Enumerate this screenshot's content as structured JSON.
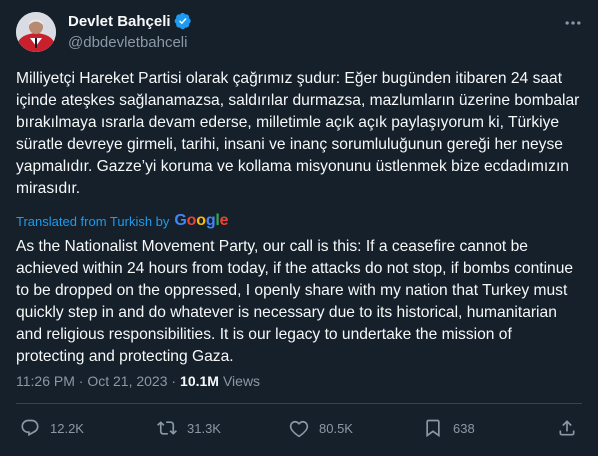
{
  "author": {
    "display_name": "Devlet Bahçeli",
    "handle": "@dbdevletbahceli"
  },
  "tweet": {
    "text": "Milliyetçi Hareket Partisi olarak çağrımız şudur: Eğer bugünden itibaren 24 saat içinde ateşkes sağlanamazsa, saldırılar durmazsa, mazlumların üzerine bombalar bırakılmaya ısrarla devam ederse, milletimle açık açık paylaşıyorum ki, Türkiye süratle devreye girmeli, tarihi, insani ve inanç sorumluluğunun gereği her neyse yapmalıdır. Gazze’yi koruma ve kollama misyonunu üstlenmek bize ecdadımızın mirasıdır.",
    "translated_label": "Translated from Turkish by",
    "translator": "Google",
    "translation": "As the Nationalist Movement Party, our call is this: If a ceasefire cannot be achieved within 24 hours from today, if the attacks do not stop, if bombs continue to be dropped on the oppressed, I openly share with my nation that Turkey must quickly step in and do whatever is necessary due to its historical, humanitarian and religious responsibilities. It is our legacy to undertake the mission of protecting and protecting Gaza.",
    "timestamp": "11:26 PM · Oct 21, 2023 ·",
    "views_count": "10.1M",
    "views_label": "Views"
  },
  "actions": {
    "replies": "12.2K",
    "retweets": "31.3K",
    "likes": "80.5K",
    "bookmarks": "638"
  },
  "colors": {
    "background": "#15202b",
    "text": "#f7f9f9",
    "secondary": "#8b98a5",
    "accent": "#1d9bf0",
    "divider": "#38444d"
  },
  "icons": [
    "verified-badge-icon",
    "more-icon",
    "reply-icon",
    "retweet-icon",
    "like-icon",
    "bookmark-icon",
    "share-icon"
  ]
}
